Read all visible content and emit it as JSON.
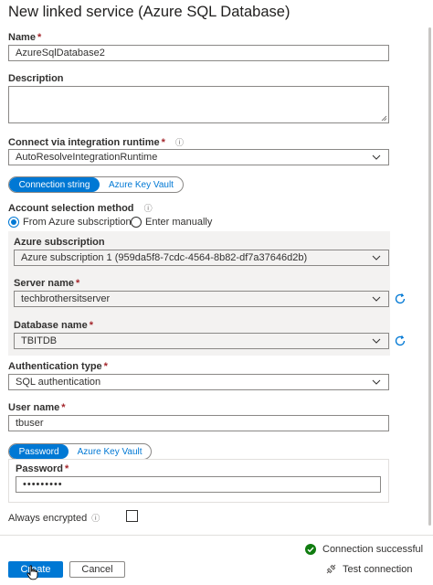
{
  "header": {
    "title": "New linked service (Azure SQL Database)"
  },
  "name": {
    "label": "Name",
    "required_mark": "*",
    "value": "AzureSqlDatabase2"
  },
  "description": {
    "label": "Description",
    "value": ""
  },
  "integration_runtime": {
    "label": "Connect via integration runtime",
    "required_mark": "*",
    "info_icon": "info-icon",
    "value": "AutoResolveIntegrationRuntime"
  },
  "connection_toggle": {
    "active": "Connection string",
    "inactive": "Azure Key Vault"
  },
  "account_selection": {
    "label": "Account selection method",
    "options": [
      {
        "label": "From Azure subscription",
        "checked": true
      },
      {
        "label": "Enter manually",
        "checked": false
      }
    ]
  },
  "subscription": {
    "label": "Azure subscription",
    "value": "Azure subscription 1 (959da5f8-7cdc-4564-8b82-df7a37646d2b)"
  },
  "server": {
    "label": "Server name",
    "required_mark": "*",
    "value": "techbrothersitserver"
  },
  "database": {
    "label": "Database name",
    "required_mark": "*",
    "value": "TBITDB"
  },
  "authentication": {
    "label": "Authentication type",
    "required_mark": "*",
    "value": "SQL authentication"
  },
  "username": {
    "label": "User name",
    "required_mark": "*",
    "value": "tbuser"
  },
  "password_toggle": {
    "active": "Password",
    "inactive": "Azure Key Vault"
  },
  "password": {
    "label": "Password",
    "required_mark": "*",
    "value": "•••••••••"
  },
  "always_encrypted": {
    "label": "Always encrypted",
    "checked": false
  },
  "footer": {
    "status": "Connection successful",
    "create_label": "Create",
    "cancel_label": "Cancel",
    "test_label": "Test connection"
  },
  "colors": {
    "accent": "#0078d4",
    "success": "#107c10",
    "required": "#a4262c"
  }
}
